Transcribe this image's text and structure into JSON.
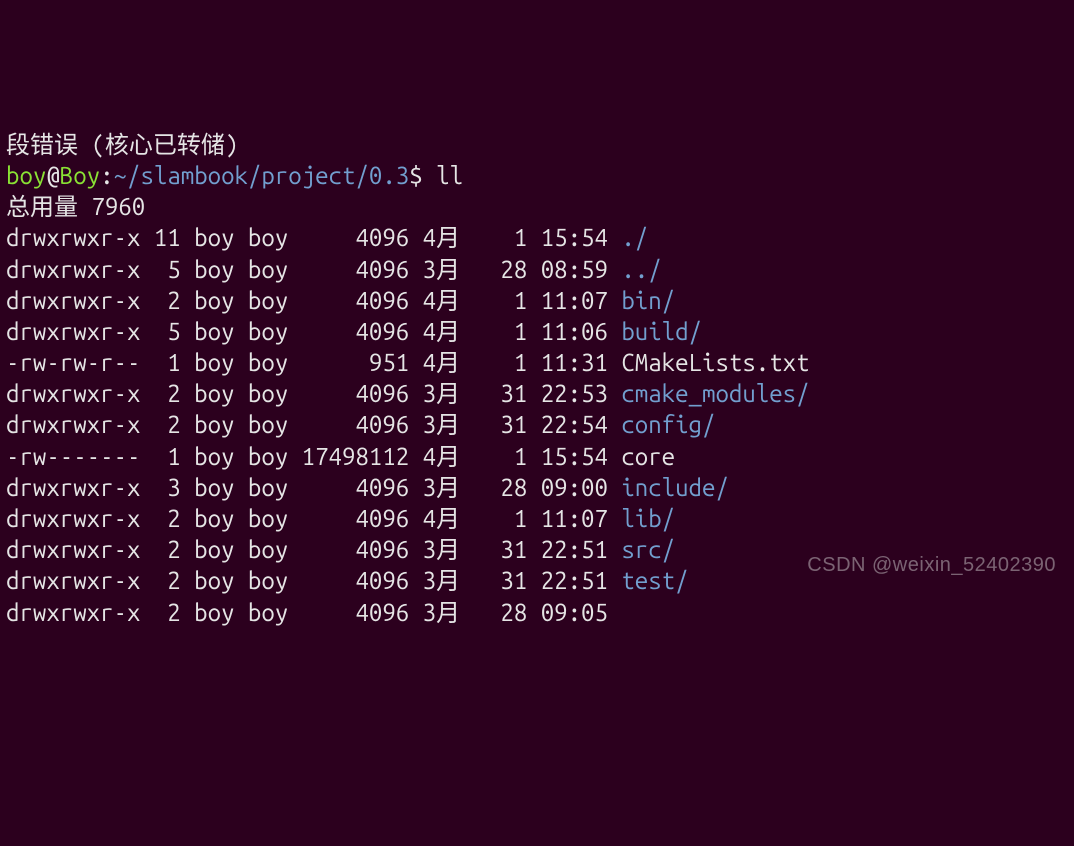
{
  "error_line": "段错误 (核心已转储)",
  "prompt": {
    "user": "boy",
    "at": "@",
    "host": "Boy",
    "colon": ":",
    "path": "~/slambook/project/0.3",
    "dollar": "$",
    "command": "ll"
  },
  "total_label": "总用量",
  "total_value": "7960",
  "listing": [
    {
      "perm": "drwxrwxr-x",
      "links": "11",
      "owner": "boy",
      "group": "boy",
      "size": "4096",
      "month": "4月",
      "day": "1",
      "time": "15:54",
      "name": "./",
      "is_dir": true
    },
    {
      "perm": "drwxrwxr-x",
      "links": "5",
      "owner": "boy",
      "group": "boy",
      "size": "4096",
      "month": "3月",
      "day": "28",
      "time": "08:59",
      "name": "../",
      "is_dir": true
    },
    {
      "perm": "drwxrwxr-x",
      "links": "2",
      "owner": "boy",
      "group": "boy",
      "size": "4096",
      "month": "4月",
      "day": "1",
      "time": "11:07",
      "name": "bin/",
      "is_dir": true
    },
    {
      "perm": "drwxrwxr-x",
      "links": "5",
      "owner": "boy",
      "group": "boy",
      "size": "4096",
      "month": "4月",
      "day": "1",
      "time": "11:06",
      "name": "build/",
      "is_dir": true
    },
    {
      "perm": "-rw-rw-r--",
      "links": "1",
      "owner": "boy",
      "group": "boy",
      "size": "951",
      "month": "4月",
      "day": "1",
      "time": "11:31",
      "name": "CMakeLists.txt",
      "is_dir": false
    },
    {
      "perm": "drwxrwxr-x",
      "links": "2",
      "owner": "boy",
      "group": "boy",
      "size": "4096",
      "month": "3月",
      "day": "31",
      "time": "22:53",
      "name": "cmake_modules/",
      "is_dir": true
    },
    {
      "perm": "drwxrwxr-x",
      "links": "2",
      "owner": "boy",
      "group": "boy",
      "size": "4096",
      "month": "3月",
      "day": "31",
      "time": "22:54",
      "name": "config/",
      "is_dir": true
    },
    {
      "perm": "-rw-------",
      "links": "1",
      "owner": "boy",
      "group": "boy",
      "size": "17498112",
      "month": "4月",
      "day": "1",
      "time": "15:54",
      "name": "core",
      "is_dir": false
    },
    {
      "perm": "drwxrwxr-x",
      "links": "3",
      "owner": "boy",
      "group": "boy",
      "size": "4096",
      "month": "3月",
      "day": "28",
      "time": "09:00",
      "name": "include/",
      "is_dir": true
    },
    {
      "perm": "drwxrwxr-x",
      "links": "2",
      "owner": "boy",
      "group": "boy",
      "size": "4096",
      "month": "4月",
      "day": "1",
      "time": "11:07",
      "name": "lib/",
      "is_dir": true
    },
    {
      "perm": "drwxrwxr-x",
      "links": "2",
      "owner": "boy",
      "group": "boy",
      "size": "4096",
      "month": "3月",
      "day": "31",
      "time": "22:51",
      "name": "src/",
      "is_dir": true
    },
    {
      "perm": "drwxrwxr-x",
      "links": "2",
      "owner": "boy",
      "group": "boy",
      "size": "4096",
      "month": "3月",
      "day": "31",
      "time": "22:51",
      "name": "test/",
      "is_dir": true
    },
    {
      "perm": "drwxrwxr-x",
      "links": "2",
      "owner": "boy",
      "group": "boy",
      "size": "4096",
      "month": "3月",
      "day": "28",
      "time": "09:05",
      "name": "",
      "is_dir": true
    }
  ],
  "watermark": "CSDN @weixin_52402390"
}
